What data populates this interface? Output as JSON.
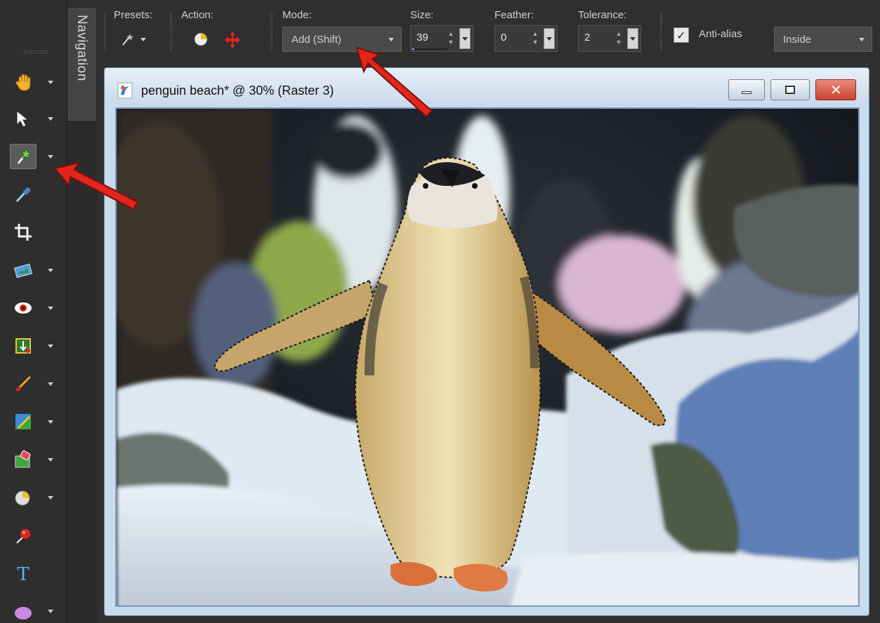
{
  "toolbar": {
    "tools": [
      {
        "name": "pan-tool",
        "icon": "hand-icon"
      },
      {
        "name": "pick-tool",
        "icon": "arrow-pointer-icon"
      },
      {
        "name": "magic-wand-tool",
        "icon": "magic-wand-icon",
        "active": true
      },
      {
        "name": "dropper-tool",
        "icon": "dropper-icon"
      },
      {
        "name": "crop-tool",
        "icon": "crop-icon"
      },
      {
        "name": "straighten-tool",
        "icon": "straighten-icon"
      },
      {
        "name": "red-eye-tool",
        "icon": "eye-icon"
      },
      {
        "name": "makeover-tool",
        "icon": "makeover-icon"
      },
      {
        "name": "paint-brush-tool",
        "icon": "brush-icon"
      },
      {
        "name": "clone-brush-tool",
        "icon": "clone-brush-icon"
      },
      {
        "name": "eraser-tool",
        "icon": "eraser-icon"
      },
      {
        "name": "dodge-tool",
        "icon": "dodge-icon"
      },
      {
        "name": "color-replacer-tool",
        "icon": "pin-icon"
      },
      {
        "name": "text-tool",
        "icon": "text-icon"
      },
      {
        "name": "shape-tool",
        "icon": "ellipse-icon"
      }
    ]
  },
  "navigation": {
    "label": "Navigation"
  },
  "options": {
    "presets_label": "Presets:",
    "action_label": "Action:",
    "mode_label": "Mode:",
    "mode_value": "Add (Shift)",
    "size_label": "Size:",
    "size_value": "39",
    "feather_label": "Feather:",
    "feather_value": "0",
    "tolerance_label": "Tolerance:",
    "tolerance_value": "2",
    "antialias_label": "Anti-alias",
    "antialias_checked": true,
    "inside_value": "Inside"
  },
  "document": {
    "title": "penguin beach* @  30% (Raster 3)"
  },
  "colors": {
    "accent_red": "#e1261c",
    "panel_bg": "#2f2f2f"
  }
}
